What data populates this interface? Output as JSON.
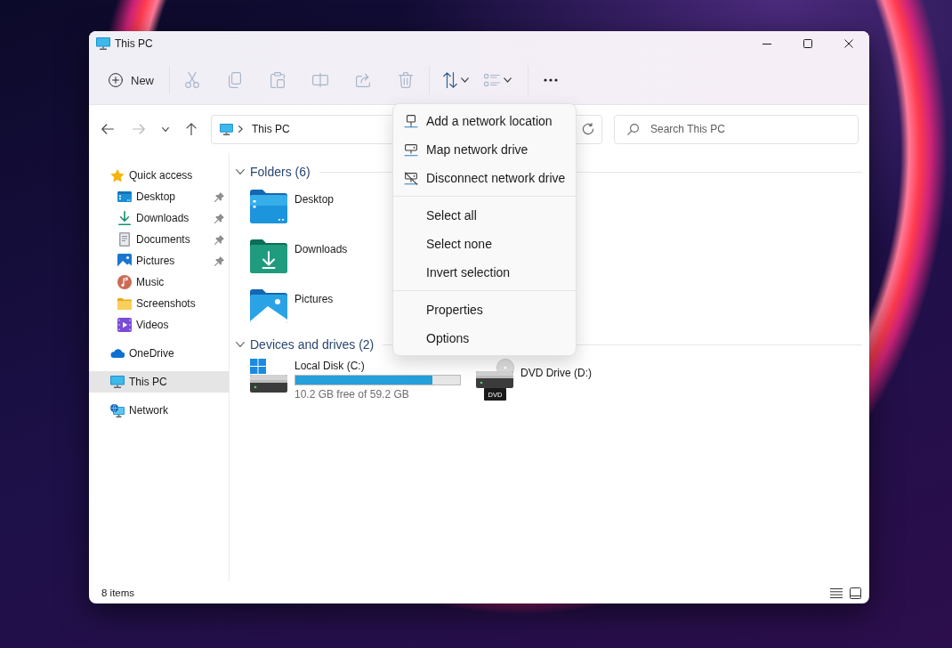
{
  "window": {
    "title": "This PC"
  },
  "toolbar": {
    "new_button": {
      "label": "New"
    },
    "actions": [
      {
        "disabled": true
      },
      {
        "disabled": true
      },
      {
        "disabled": true
      },
      {
        "disabled": true
      },
      {
        "disabled": true
      },
      {
        "disabled": true
      }
    ],
    "sort_button": {
      "disabled": false
    },
    "view_button": {
      "disabled": true
    }
  },
  "navigation": {
    "back": {
      "disabled": false
    },
    "forward": {
      "disabled": true
    },
    "up": {
      "disabled": false
    }
  },
  "address_bar": {
    "segments": [
      "This PC"
    ]
  },
  "search": {
    "placeholder": "Search This PC"
  },
  "sidebar": {
    "items": [
      {
        "label": "Quick access",
        "selected": false,
        "children": [
          {
            "label": "Desktop",
            "selected": false,
            "pinned": true
          },
          {
            "label": "Downloads",
            "selected": false,
            "pinned": true
          },
          {
            "label": "Documents",
            "selected": false,
            "pinned": true
          },
          {
            "label": "Pictures",
            "selected": false,
            "pinned": true
          },
          {
            "label": "Music",
            "selected": false,
            "pinned": false
          },
          {
            "label": "Screenshots",
            "selected": false,
            "pinned": false
          },
          {
            "label": "Videos",
            "selected": false,
            "pinned": false
          }
        ]
      },
      {
        "label": "OneDrive",
        "selected": false
      },
      {
        "label": "This PC",
        "selected": true
      },
      {
        "label": "Network",
        "selected": false
      }
    ]
  },
  "content": {
    "sections": [
      {
        "kind": "folders",
        "title": "Folders (6)",
        "expanded": true,
        "items": [
          {
            "name": "Desktop"
          },
          {
            "name": "Downloads"
          },
          {
            "name": "Pictures"
          }
        ]
      },
      {
        "kind": "drives",
        "title": "Devices and drives (2)",
        "expanded": true,
        "items": [
          {
            "kind": "disk",
            "name": "Local Disk (C:)",
            "level": 0.83,
            "space": "10.2 GB free of 59.2 GB"
          },
          {
            "kind": "optical",
            "name": "DVD Drive (D:)",
            "badge": "DVD"
          }
        ]
      }
    ]
  },
  "context_menu": {
    "groups": [
      {
        "items": [
          {
            "label": "Add a network location"
          },
          {
            "label": "Map network drive"
          },
          {
            "label": "Disconnect network drive"
          }
        ]
      },
      {
        "items": [
          {
            "label": "Select all"
          },
          {
            "label": "Select none"
          },
          {
            "label": "Invert selection"
          }
        ]
      },
      {
        "items": [
          {
            "label": "Properties"
          },
          {
            "label": "Options"
          }
        ]
      }
    ]
  },
  "status_bar": {
    "item_count": "8 items"
  }
}
